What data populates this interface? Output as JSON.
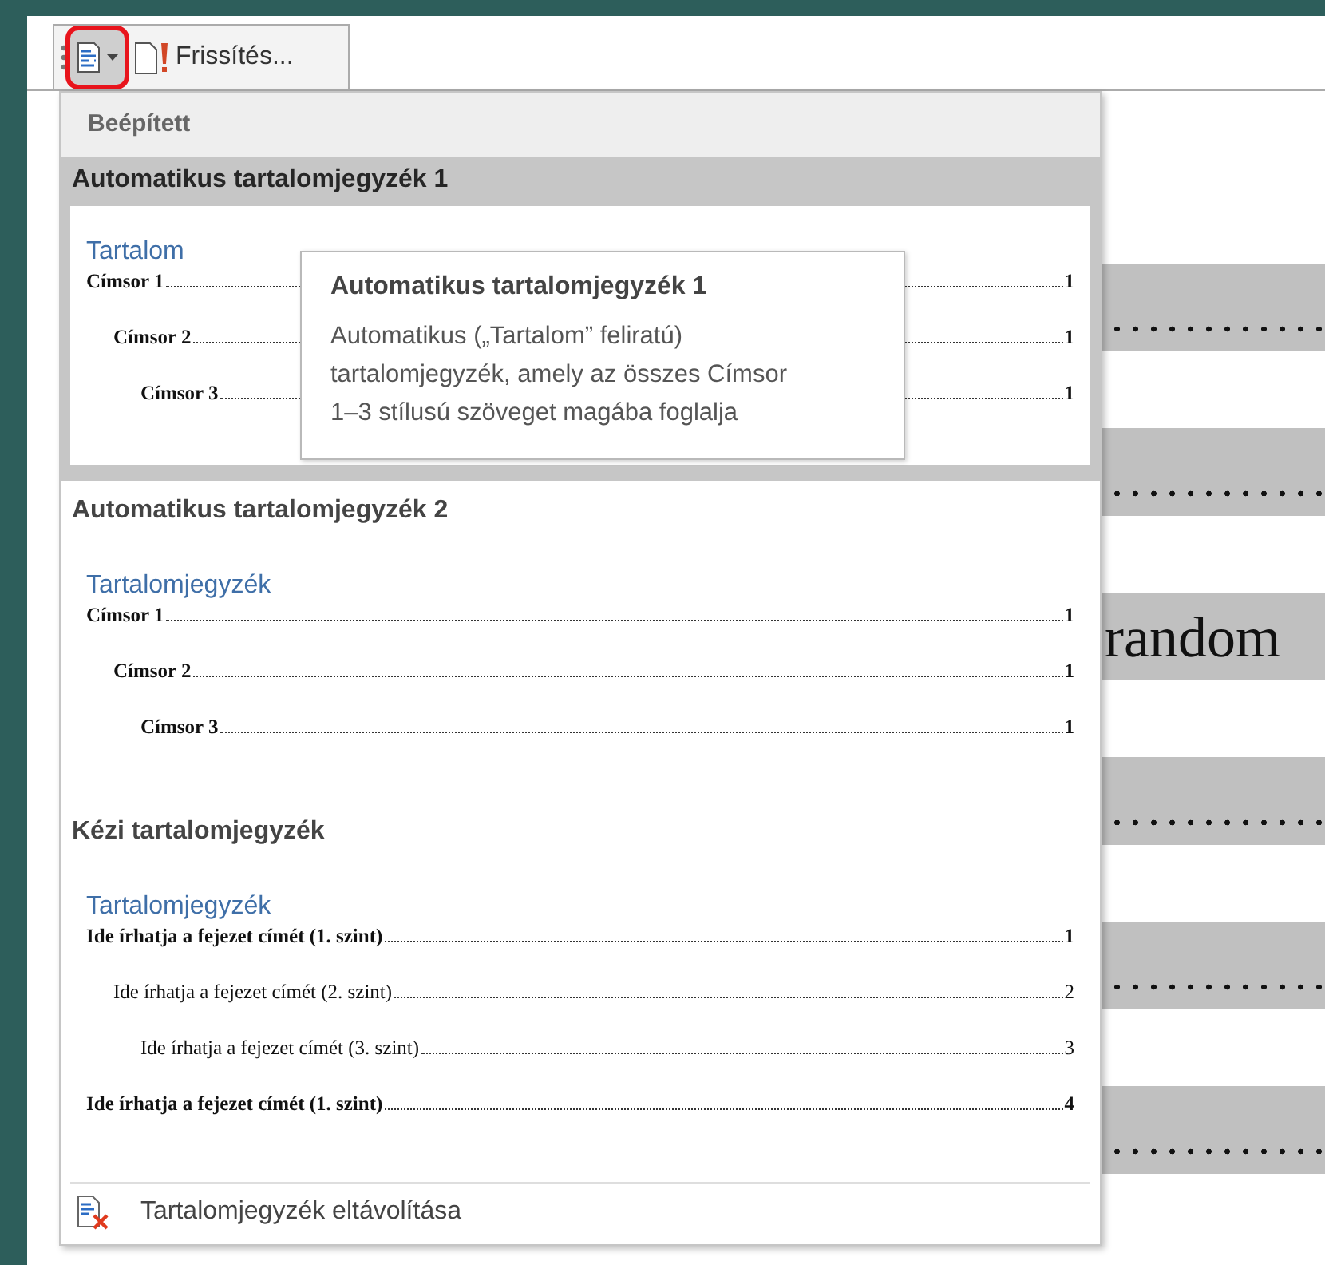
{
  "toolbar": {
    "buttons": [
      {
        "kind": "toc-menu",
        "selected": true
      },
      {
        "kind": "update",
        "label": "Frissítés...",
        "selected": false
      }
    ]
  },
  "menu": {
    "header": "Beépített",
    "sections": [
      {
        "title": "Automatikus tartalomjegyzék 1",
        "selected": true,
        "preview": {
          "heading": "Tartalom",
          "entries": [
            {
              "text": "Címsor 1",
              "page": "1",
              "bold": true,
              "children": [
                {
                  "text": "Címsor 2",
                  "page": "1",
                  "bold": true,
                  "children": [
                    {
                      "text": "Címsor 3",
                      "page": "1",
                      "bold": true
                    }
                  ]
                }
              ]
            }
          ]
        }
      },
      {
        "title": "Automatikus tartalomjegyzék 2",
        "selected": false,
        "preview": {
          "heading": "Tartalomjegyzék",
          "entries": [
            {
              "text": "Címsor 1",
              "page": "1",
              "bold": true,
              "children": [
                {
                  "text": "Címsor 2",
                  "page": "1",
                  "bold": true,
                  "children": [
                    {
                      "text": "Címsor 3",
                      "page": "1",
                      "bold": true
                    }
                  ]
                }
              ]
            }
          ]
        }
      },
      {
        "title": "Kézi tartalomjegyzék",
        "selected": false,
        "preview": {
          "heading": "Tartalomjegyzék",
          "entries": [
            {
              "text": "Ide írhatja a fejezet címét (1. szint)",
              "page": "1",
              "bold": true,
              "children": [
                {
                  "text": "Ide írhatja a fejezet címét (2. szint)",
                  "page": "2",
                  "bold": false,
                  "children": [
                    {
                      "text": "Ide írhatja a fejezet címét (3. szint)",
                      "page": "3",
                      "bold": false
                    }
                  ]
                }
              ]
            },
            {
              "text": "Ide írhatja a fejezet címét (1. szint)",
              "page": "4",
              "bold": true
            }
          ]
        }
      }
    ],
    "footer": {
      "label": "Tartalomjegyzék eltávolítása"
    }
  },
  "tooltip": {
    "title": "Automatikus tartalomjegyzék 1",
    "text": "Automatikus („Tartalom” feliratú) tartalomjegyzék, amely az összes Címsor 1–3 stílusú szöveget magába foglalja"
  },
  "document": {
    "rows": [
      {
        "kind": "leader"
      },
      {
        "kind": "leader"
      },
      {
        "kind": "text",
        "text": "random"
      },
      {
        "kind": "leader"
      },
      {
        "kind": "leader"
      },
      {
        "kind": "leader"
      }
    ]
  }
}
